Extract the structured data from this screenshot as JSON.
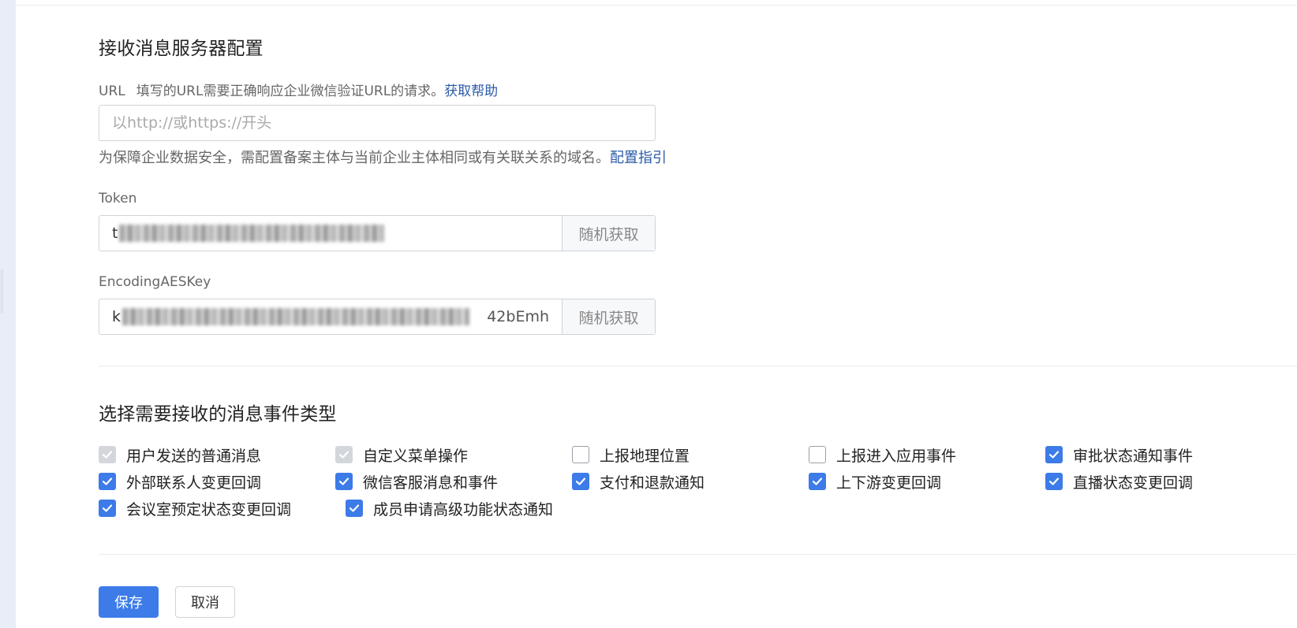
{
  "server_config": {
    "title": "接收消息服务器配置",
    "url_label": "URL",
    "url_desc": "填写的URL需要正确响应企业微信验证URL的请求。",
    "url_help_link": "获取帮助",
    "url_placeholder": "以http://或https://开头",
    "url_value": "",
    "domain_hint": "为保障企业数据安全，需配置备案主体与当前企业主体相同或有关联关系的域名。",
    "domain_guide_link": "配置指引",
    "token_label": "Token",
    "token_value_visible_prefix": "t",
    "token_random_button": "随机获取",
    "aes_label": "EncodingAESKey",
    "aes_value_visible_prefix": "k",
    "aes_value_visible_suffix": "42bEmh",
    "aes_random_button": "随机获取"
  },
  "events": {
    "title": "选择需要接收的消息事件类型",
    "items": [
      {
        "label": "用户发送的普通消息",
        "state": "disabled-checked"
      },
      {
        "label": "自定义菜单操作",
        "state": "disabled-checked"
      },
      {
        "label": "上报地理位置",
        "state": "unchecked"
      },
      {
        "label": "上报进入应用事件",
        "state": "unchecked"
      },
      {
        "label": "审批状态通知事件",
        "state": "checked"
      },
      {
        "label": "外部联系人变更回调",
        "state": "checked"
      },
      {
        "label": "微信客服消息和事件",
        "state": "checked"
      },
      {
        "label": "支付和退款通知",
        "state": "checked"
      },
      {
        "label": "上下游变更回调",
        "state": "checked"
      },
      {
        "label": "直播状态变更回调",
        "state": "checked"
      },
      {
        "label": "会议室预定状态变更回调",
        "state": "checked"
      },
      {
        "label": "成员申请高级功能状态通知",
        "state": "checked"
      }
    ]
  },
  "actions": {
    "save_label": "保存",
    "cancel_label": "取消"
  },
  "colors": {
    "accent": "#3c7be8",
    "link": "#2a5aa8",
    "disabled_checkbox": "#d3d6db"
  }
}
